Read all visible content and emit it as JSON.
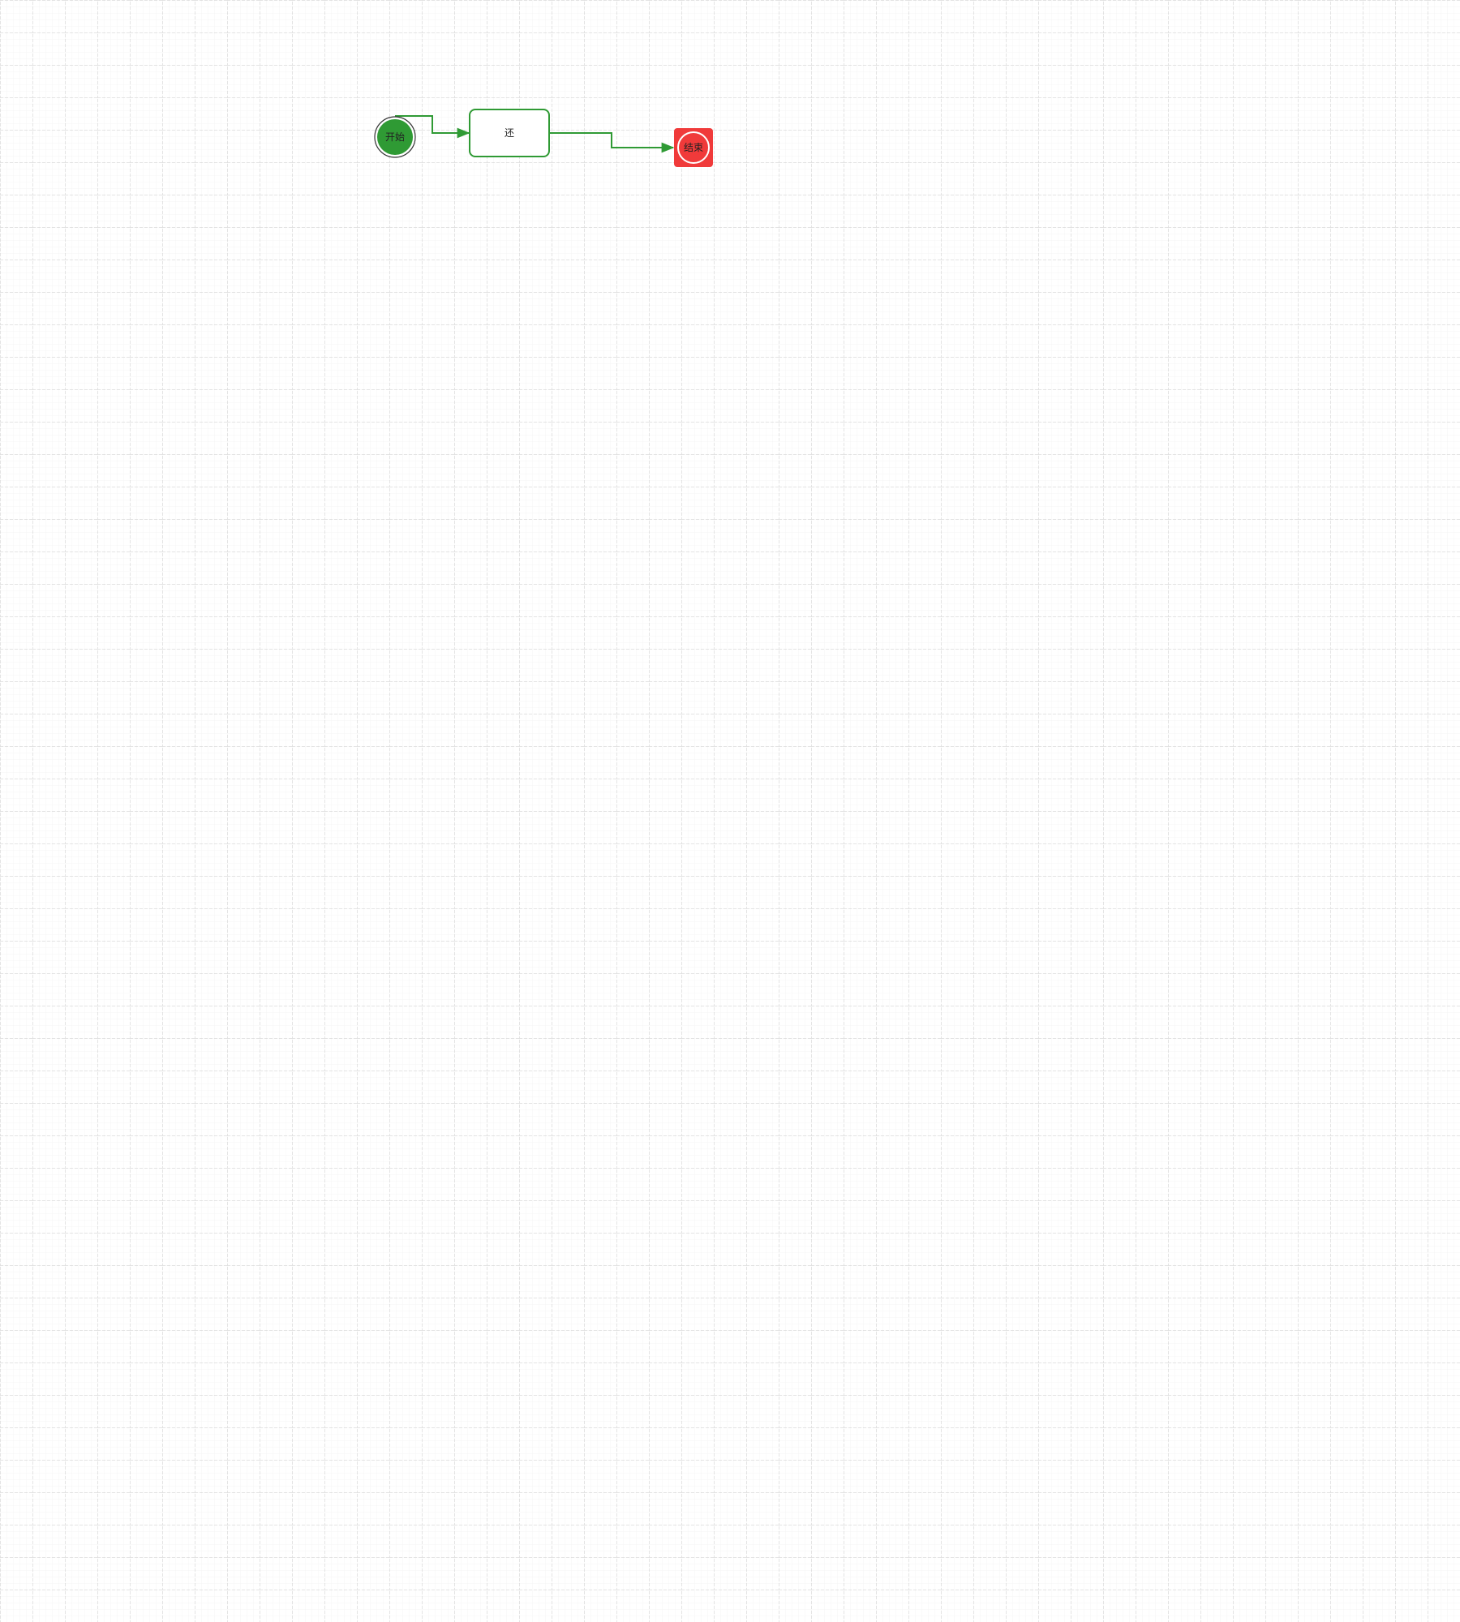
{
  "diagram": {
    "colors": {
      "grid_line": "#c8c8c8",
      "grid_line_minor": "#e6e6e6",
      "edge": "#2f9a34",
      "start_fill": "#2f9a34",
      "start_ring": "#333333",
      "task_border": "#2f9a34",
      "end_fill": "#f03a3a",
      "end_inner_ring": "#ffffff"
    },
    "nodes": {
      "start": {
        "label": "开始",
        "shape": "circle"
      },
      "task": {
        "label": "还",
        "shape": "rounded-rect"
      },
      "end": {
        "label": "结束",
        "shape": "rounded-square-with-circle"
      }
    },
    "edges": [
      {
        "from": "start",
        "to": "task"
      },
      {
        "from": "task",
        "to": "end"
      }
    ]
  }
}
